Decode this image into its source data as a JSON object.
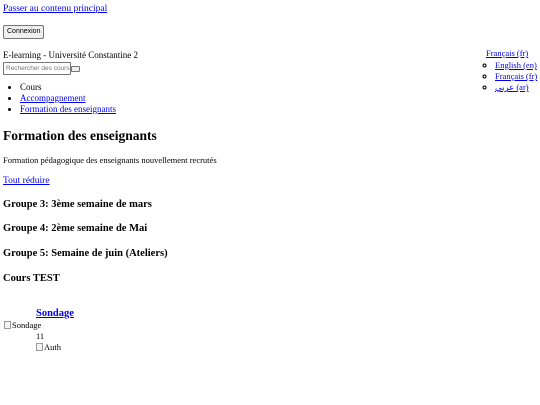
{
  "header": {
    "skip_link": "Passer au contenu principal",
    "login_button": "Connexion",
    "site_name": "E-learning - Université Constantine 2",
    "search": {
      "placeholder": "Rechercher des cours",
      "value": ""
    }
  },
  "language_menu": {
    "current": "Français (fr)",
    "options": [
      "English (en)",
      "Français (fr)",
      "عربي (ar)"
    ]
  },
  "breadcrumb": [
    "Cours",
    "Accompagnement",
    "Formation des enseignants"
  ],
  "course": {
    "title": "Formation des enseignants",
    "summary": "Formation pédagogique des enseignants nouvellement recrutés",
    "collapse_all": "Tout réduire",
    "sections": [
      "Groupe 3: 3ème semaine de mars",
      "Groupe 4: 2ème semaine de Mai",
      "Groupe 5: Semaine de juin (Ateliers)",
      "Cours TEST"
    ]
  },
  "activity": {
    "icon_alt": "Sondage",
    "name": "Sondage",
    "count": "11",
    "auth_alt": "Auth"
  }
}
